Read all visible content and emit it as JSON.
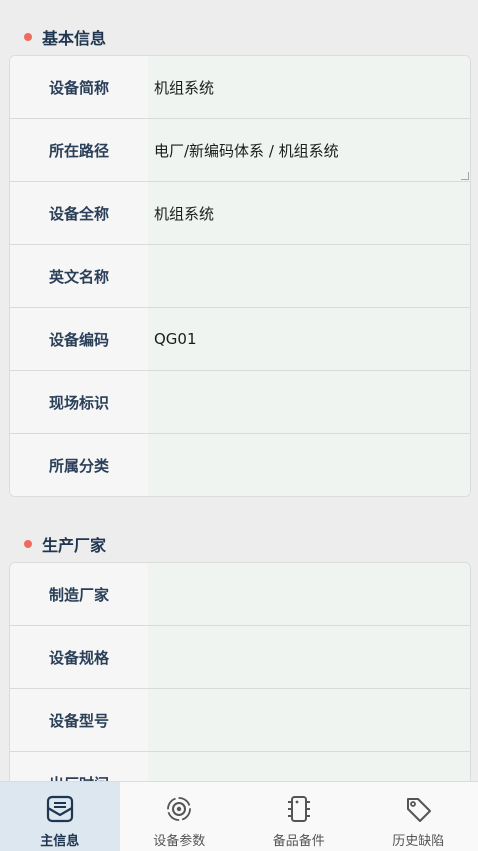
{
  "basic_info": {
    "title": "基本信息",
    "rows": [
      {
        "label": "设备简称",
        "value": "机组系统"
      },
      {
        "label": "所在路径",
        "value": "电厂/新编码体系 / 机组系统"
      },
      {
        "label": "设备全称",
        "value": "机组系统"
      },
      {
        "label": "英文名称",
        "value": ""
      },
      {
        "label": "设备编码",
        "value": "QG01"
      },
      {
        "label": "现场标识",
        "value": ""
      },
      {
        "label": "所属分类",
        "value": ""
      }
    ]
  },
  "manufacturer": {
    "title": "生产厂家",
    "rows": [
      {
        "label": "制造厂家",
        "value": ""
      },
      {
        "label": "设备规格",
        "value": ""
      },
      {
        "label": "设备型号",
        "value": ""
      },
      {
        "label": "出厂时间",
        "value": ""
      }
    ]
  },
  "tabbar": {
    "tabs": [
      {
        "label": "主信息",
        "icon": "mail-stack-icon",
        "active": true
      },
      {
        "label": "设备参数",
        "icon": "gear-cycle-icon",
        "active": false
      },
      {
        "label": "备品备件",
        "icon": "chip-icon",
        "active": false
      },
      {
        "label": "历史缺陷",
        "icon": "tag-icon",
        "active": false
      }
    ]
  },
  "colors": {
    "accent_dot": "#ef6b5e",
    "active_tab_bg": "#dde7ef",
    "value_bg": "#eff4f1"
  }
}
